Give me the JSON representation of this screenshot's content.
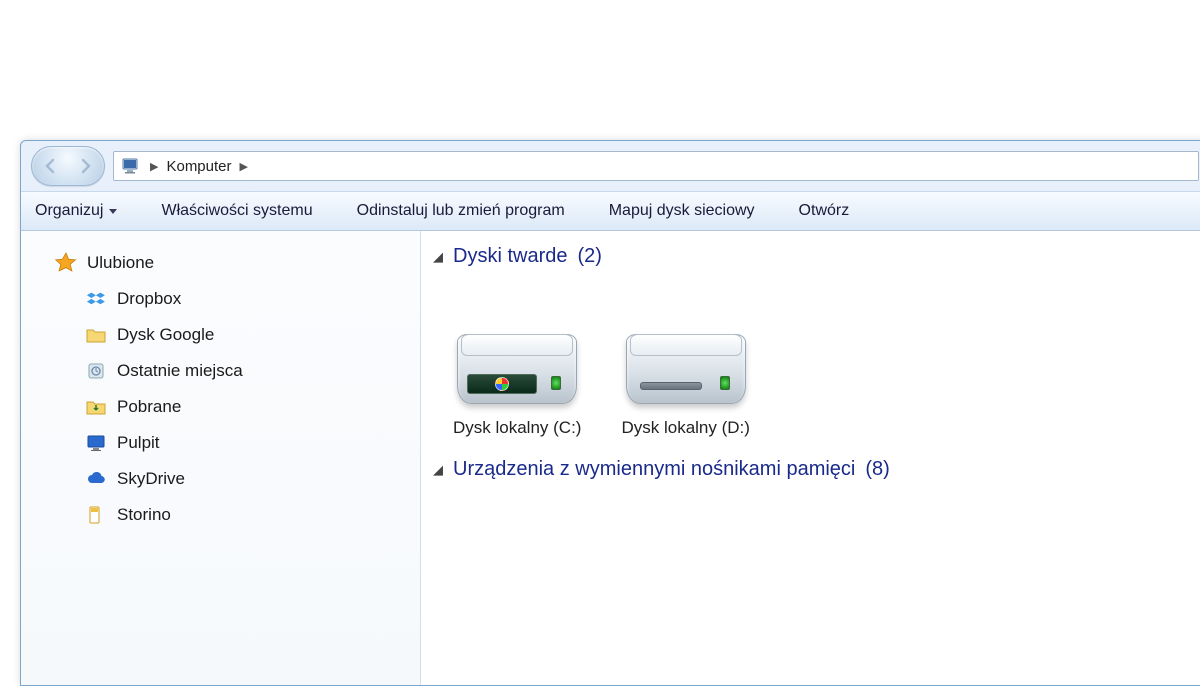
{
  "breadcrumb": {
    "root": "Komputer"
  },
  "toolbar": {
    "organize": "Organizuj",
    "system_properties": "Właściwości systemu",
    "uninstall": "Odinstaluj lub zmień program",
    "map_drive": "Mapuj dysk sieciowy",
    "open": "Otwórz"
  },
  "sidebar": {
    "favorites": "Ulubione",
    "items": [
      {
        "label": "Dropbox",
        "icon": "dropbox-icon"
      },
      {
        "label": "Dysk Google",
        "icon": "google-drive-folder-icon"
      },
      {
        "label": "Ostatnie miejsca",
        "icon": "recent-places-icon"
      },
      {
        "label": "Pobrane",
        "icon": "downloads-folder-icon"
      },
      {
        "label": "Pulpit",
        "icon": "desktop-icon"
      },
      {
        "label": "SkyDrive",
        "icon": "skydrive-icon"
      },
      {
        "label": "Storino",
        "icon": "storino-icon"
      }
    ]
  },
  "groups": {
    "hard_drives": {
      "label": "Dyski twarde",
      "count": 2
    },
    "removable": {
      "label": "Urządzenia z wymiennymi nośnikami pamięci",
      "count": 8
    }
  },
  "drives": [
    {
      "label": "Dysk lokalny (C:)",
      "system": true
    },
    {
      "label": "Dysk lokalny (D:)",
      "system": false
    }
  ]
}
